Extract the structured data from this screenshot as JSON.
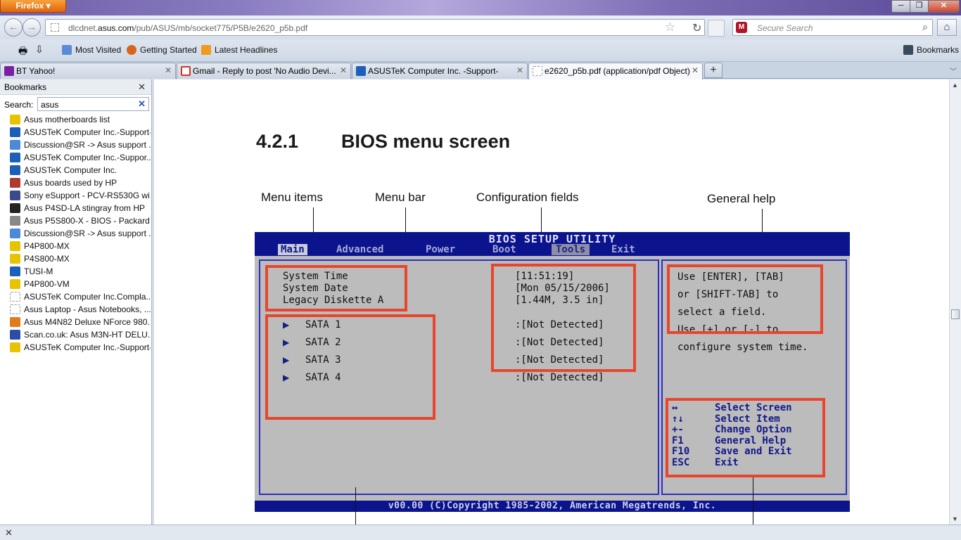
{
  "window": {
    "app_button": "Firefox",
    "controls": {
      "minimize": "─",
      "maximize": "❐",
      "close": "✕"
    }
  },
  "nav": {
    "back": "←",
    "forward": "→",
    "url_prefix": "dlcdnet.",
    "url_host": "asus.com",
    "url_path": "/pub/ASUS/mb/socket775/P5B/e2620_p5b.pdf",
    "star": "☆",
    "reload": "↻",
    "search_placeholder": "Secure Search",
    "search_engine_icon_text": "M",
    "search_glass": "⌕",
    "home": "⌂"
  },
  "bookmarks_toolbar": {
    "items": [
      "Most Visited",
      "Getting Started",
      "Latest Headlines"
    ],
    "right_item": "Bookmarks",
    "print_icon": "🖶",
    "download_icon": "⇩"
  },
  "tabs": [
    {
      "label": "BT Yahoo!",
      "icon_color": "#7b1fa2",
      "close": "✕"
    },
    {
      "label": "Gmail - Reply to post 'No Audio Devi...",
      "icon_color": "#d93025",
      "close": "✕"
    },
    {
      "label": "ASUSTeK Computer Inc. -Support-",
      "icon_color": "#1b5fb8",
      "close": "✕"
    },
    {
      "label": "e2620_p5b.pdf (application/pdf Object)",
      "icon_color": "#ffffff",
      "close": "✕"
    }
  ],
  "new_tab": "+",
  "all_tabs": "﹀",
  "sidebar": {
    "title": "Bookmarks",
    "close": "✕",
    "search_label": "Search:",
    "search_value": "asus",
    "search_clear": "✕",
    "items": [
      {
        "label": "Asus motherboards list",
        "icon": "asus-logo-icon",
        "color": "#e8c400"
      },
      {
        "label": "ASUSTeK Computer Inc.-Support-",
        "icon": "asus-support-icon",
        "color": "#1b5fb8"
      },
      {
        "label": "Discussion@SR -> Asus support ...",
        "icon": "storagereview-icon",
        "color": "#4a8ad8"
      },
      {
        "label": "ASUSTeK Computer Inc.-Suppor...",
        "icon": "asus-support-icon",
        "color": "#1b5fb8"
      },
      {
        "label": "ASUSTeK Computer Inc.",
        "icon": "asus-support-icon",
        "color": "#1b5fb8"
      },
      {
        "label": "Asus boards used by HP",
        "icon": "hp-boards-icon",
        "color": "#b03a2e"
      },
      {
        "label": "Sony eSupport - PCV-RS530G wi...",
        "icon": "sony-icon",
        "color": "#3a4a8a"
      },
      {
        "label": "Asus P4SD-LA stingray from HP",
        "icon": "hp-icon",
        "color": "#222222"
      },
      {
        "label": "Asus P5S800-X - BIOS - Packard ...",
        "icon": "packard-bell-icon",
        "color": "#888888"
      },
      {
        "label": "Discussion@SR -> Asus support ...",
        "icon": "storagereview-icon",
        "color": "#4a8ad8"
      },
      {
        "label": "P4P800-MX",
        "icon": "asus-logo-icon",
        "color": "#e8c400"
      },
      {
        "label": "P4S800-MX",
        "icon": "asus-logo-icon",
        "color": "#e8c400"
      },
      {
        "label": "TUSI-M",
        "icon": "asus-support-icon",
        "color": "#1b5fb8"
      },
      {
        "label": "P4P800-VM",
        "icon": "asus-logo-icon",
        "color": "#e8c400"
      },
      {
        "label": "ASUSTeK Computer Inc.Compla...",
        "icon": "blank-page-icon",
        "color": "#ffffff"
      },
      {
        "label": "Asus Laptop - Asus Notebooks, ...",
        "icon": "blank-page-icon",
        "color": "#ffffff"
      },
      {
        "label": "Asus M4N82 Deluxe NForce 980...",
        "icon": "ie-icon",
        "color": "#e07a1a"
      },
      {
        "label": "Scan.co.uk: Asus M3N-HT DELU...",
        "icon": "scan-icon",
        "color": "#2a4ea8"
      },
      {
        "label": "ASUSTeK Computer Inc.-Support-",
        "icon": "asus-logo-icon",
        "color": "#e8c400"
      }
    ]
  },
  "doc": {
    "section_number": "4.2.1",
    "section_title": "BIOS menu screen",
    "callouts": {
      "menu_items": "Menu items",
      "menu_bar": "Menu bar",
      "config_fields": "Configuration fields",
      "general_help": "General help"
    },
    "bios": {
      "title": "BIOS SETUP UTILITY",
      "menus": [
        "Main",
        "Advanced",
        "Power",
        "Boot",
        "Tools",
        "Exit"
      ],
      "items": [
        "System Time",
        "System Date",
        "Legacy Diskette A"
      ],
      "values": [
        "[11:51:19]",
        "[Mon 05/15/2006]",
        "[1.44M, 3.5 in]"
      ],
      "sata_items": [
        "SATA 1",
        "SATA 2",
        "SATA 3",
        "SATA 4"
      ],
      "sata_values": [
        ":[Not Detected]",
        ":[Not Detected]",
        ":[Not Detected]",
        ":[Not Detected]"
      ],
      "arrow": "▶",
      "help_lines": [
        "Use [ENTER], [TAB]",
        "or [SHIFT-TAB] to",
        "select a field.",
        "Use [+] or [-] to",
        "configure system time."
      ],
      "keys": [
        {
          "key": "↔",
          "action": "Select Screen"
        },
        {
          "key": "↑↓",
          "action": "Select Item"
        },
        {
          "key": "+-",
          "action": "Change Option"
        },
        {
          "key": "F1",
          "action": "General Help"
        },
        {
          "key": "F10",
          "action": "Save and Exit"
        },
        {
          "key": "ESC",
          "action": "Exit"
        }
      ],
      "footer": "v00.00 (C)Copyright 1985-2002, American Megatrends, Inc."
    }
  },
  "status": {
    "close": "✕"
  },
  "scrollbar": {
    "up": "▲",
    "down": "▼"
  }
}
